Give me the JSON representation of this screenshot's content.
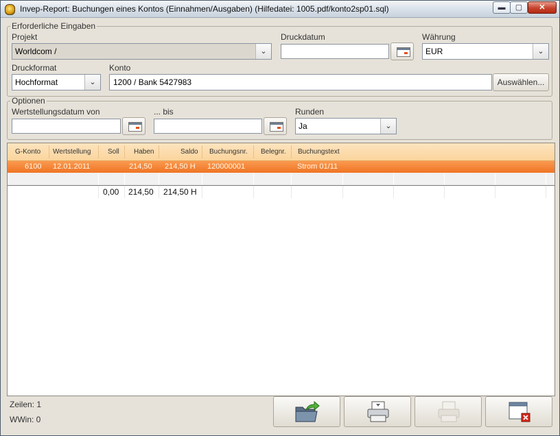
{
  "window": {
    "title": "Invep-Report: Buchungen eines Kontos (Einnahmen/Ausgaben)   (Hilfedatei: 1005.pdf/konto2sp01.sql)",
    "controls": {
      "minimize": "▬",
      "maximize": "▢",
      "close": "✕"
    }
  },
  "required": {
    "legend": "Erforderliche Eingaben",
    "projekt": {
      "label": "Projekt",
      "value": "Worldcom /"
    },
    "druckdatum": {
      "label": "Druckdatum",
      "value": ""
    },
    "waehrung": {
      "label": "Währung",
      "value": "EUR"
    },
    "druckformat": {
      "label": "Druckformat",
      "value": "Hochformat"
    },
    "konto": {
      "label": "Konto",
      "value": "1200 / Bank 5427983"
    },
    "auswaehlen_button": "Auswählen..."
  },
  "optionen": {
    "legend": "Optionen",
    "von": {
      "label": "Wertstellungsdatum von",
      "value": ""
    },
    "bis": {
      "label": "... bis",
      "value": ""
    },
    "runden": {
      "label": "Runden",
      "value": "Ja"
    }
  },
  "grid": {
    "columns": [
      "G-Konto",
      "Wertstellung",
      "Soll",
      "Haben",
      "Saldo",
      "Buchungsnr.",
      "Belegnr.",
      "Buchungstext"
    ],
    "rows": [
      {
        "gkonto": "6100",
        "wertstellung": "12.01.2011",
        "soll": "",
        "haben": "214,50",
        "saldo": "214,50 H",
        "buchungsnr": "120000001",
        "belegnr": "",
        "buchungstext": "Strom 01/11"
      }
    ],
    "totals": {
      "soll": "0,00",
      "haben": "214,50",
      "saldo": "214,50 H"
    }
  },
  "status": {
    "zeilen": "Zeilen: 1",
    "wwin": "WWin: 0"
  },
  "icons": {
    "export": "folder-export-icon",
    "print": "printer-icon",
    "print_disabled": "printer-disabled-icon",
    "close": "window-close-icon"
  },
  "colors": {
    "selection": "#ef7424",
    "header": "#fbd49c"
  }
}
